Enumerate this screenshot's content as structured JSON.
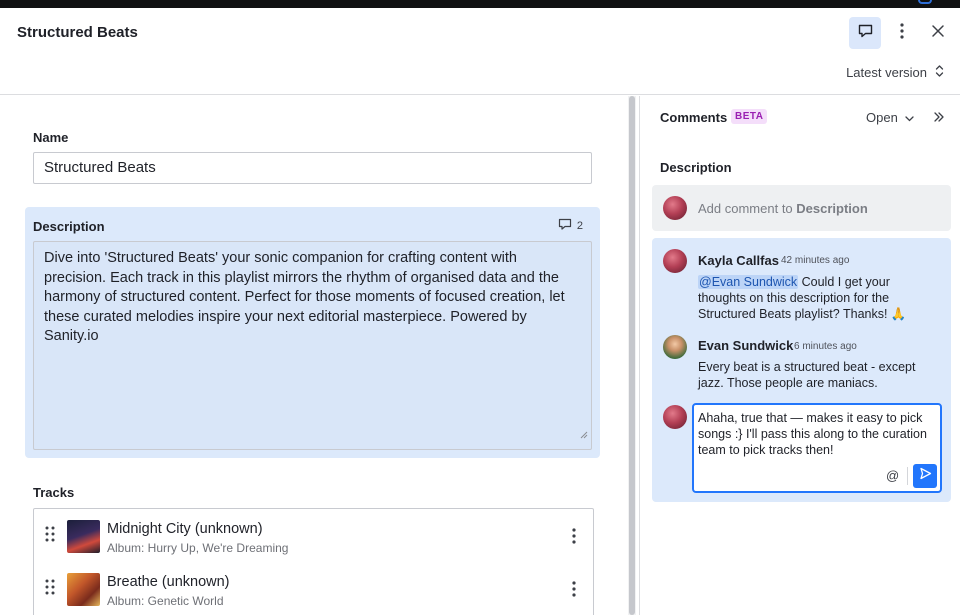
{
  "document": {
    "title": "Structured Beats",
    "version_label": "Latest version"
  },
  "form": {
    "name_label": "Name",
    "name_value": "Structured Beats",
    "description_label": "Description",
    "description_comment_count": "2",
    "description_value": "Dive into 'Structured Beats' your sonic companion for crafting content with precision. Each track in this playlist mirrors the rhythm of organised data and the harmony of structured content. Perfect for those moments of focused creation, let these curated melodies inspire your next editorial masterpiece. Powered by Sanity.io",
    "tracks_label": "Tracks",
    "tracks": [
      {
        "title": "Midnight City (unknown)",
        "subtitle": "Album: Hurry Up, We're Dreaming"
      },
      {
        "title": "Breathe (unknown)",
        "subtitle": "Album: Genetic World"
      }
    ]
  },
  "comments": {
    "title": "Comments",
    "badge": "BETA",
    "filter_label": "Open",
    "field_title": "Description",
    "add_placeholder_prefix": "Add comment to ",
    "add_placeholder_field": "Description",
    "thread": [
      {
        "author": "Kayla Callfas",
        "time": "42 minutes ago",
        "mention": "@Evan Sundwick",
        "text": " Could I get your thoughts on this description for the Structured Beats playlist? Thanks! 🙏"
      },
      {
        "author": "Evan Sundwick",
        "time": "6 minutes ago",
        "mention": "",
        "text": "Every beat is a structured beat - except jazz. Those people are maniacs."
      }
    ],
    "reply_draft": "Ahaha, true that — makes it easy to pick songs :} I'll pass this along to the curation team to pick tracks then!",
    "at_symbol": "@"
  },
  "colors": {
    "accent": "#2276fc",
    "highlight": "#dce9fb",
    "beta_badge": "#f4defa"
  }
}
